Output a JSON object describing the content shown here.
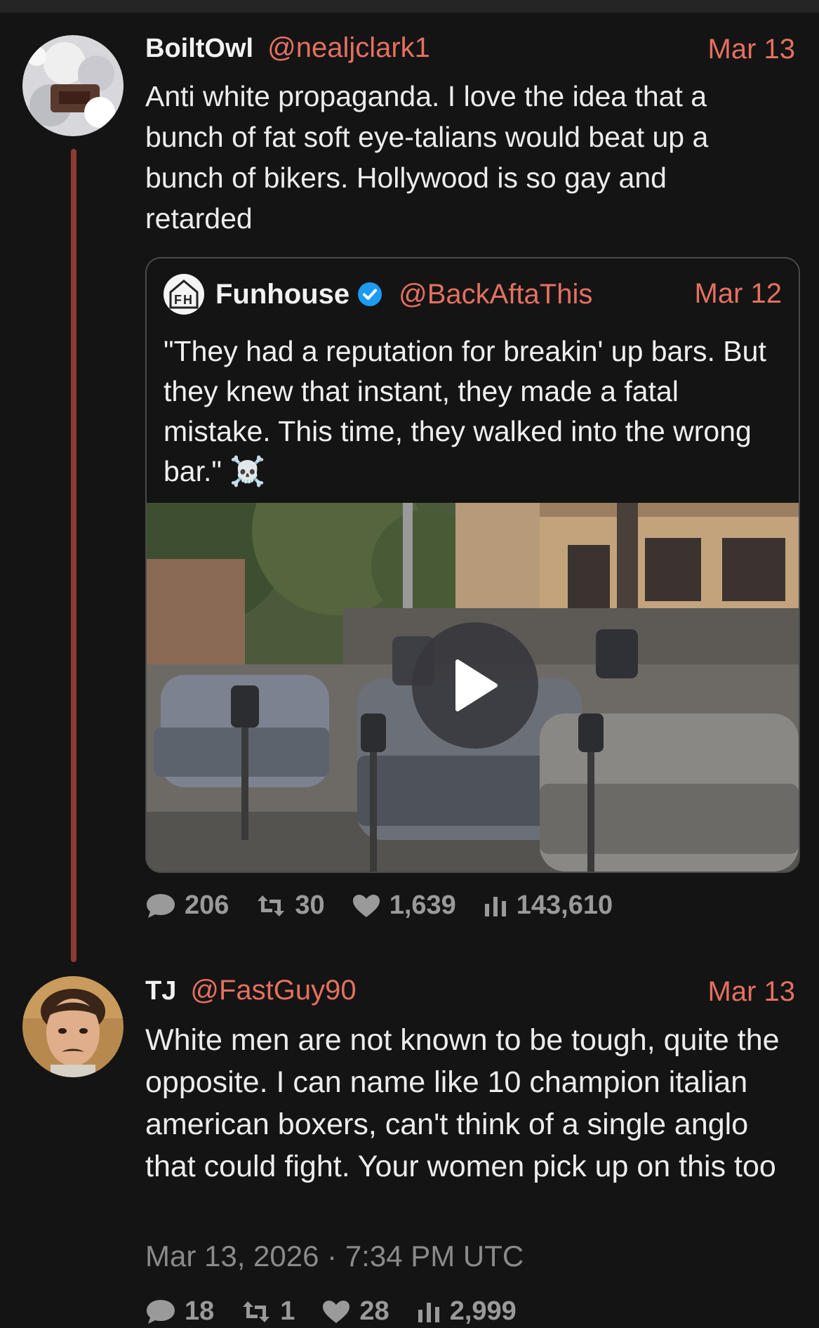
{
  "tweet1": {
    "username": "BoiltOwl",
    "handle": "@nealjclark1",
    "date": "Mar 13",
    "text": "Anti white propaganda. I love the idea that a bunch of fat soft eye-talians would beat up a bunch of bikers. Hollywood is so gay and retarded",
    "stats": {
      "comments": "206",
      "retweets": "30",
      "likes": "1,639",
      "views": "143,610"
    }
  },
  "quote": {
    "username": "Funhouse",
    "handle": "@BackAftaThis",
    "date": "Mar 12",
    "text": "\"They had a reputation for breakin' up bars. But they knew that instant, they made a fatal mistake. This time, they walked into the wrong bar.\" ☠️"
  },
  "tweet2": {
    "username": "TJ",
    "handle": "@FastGuy90",
    "date": "Mar 13",
    "text": "White men are not known to be tough, quite the opposite.  I can name like 10 champion italian american boxers, can't think of a single anglo that could fight. Your women pick up on this too",
    "timestamp": "Mar 13, 2026 · 7:34 PM UTC",
    "stats": {
      "comments": "18",
      "retweets": "1",
      "likes": "28",
      "views": "2,999"
    }
  },
  "icons": [
    "comment-icon",
    "retweet-icon",
    "heart-icon",
    "views-icon",
    "verified-icon",
    "play-icon"
  ],
  "colors": {
    "background": "#141414",
    "accent": "#e5705f",
    "thread_line": "#8e3a33",
    "verified": "#1d9bf0",
    "muted": "#9a9a9a"
  }
}
